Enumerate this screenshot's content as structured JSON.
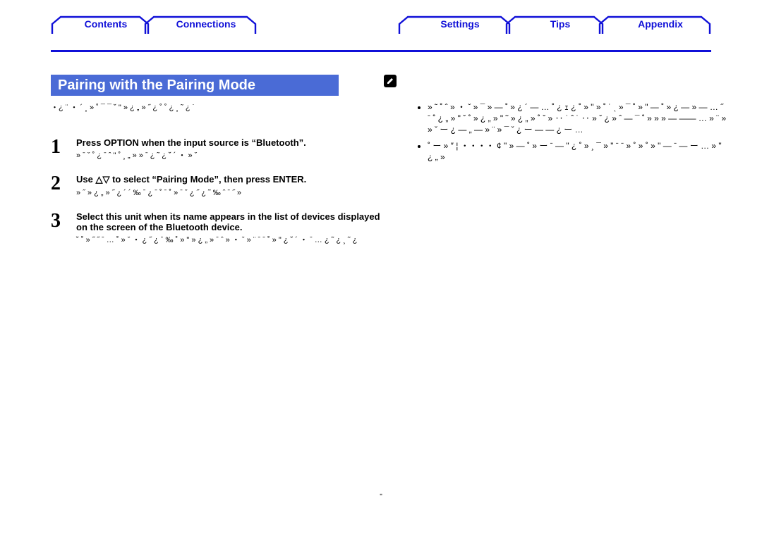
{
  "nav": {
    "contents": "Contents",
    "connections": "Connections",
    "settings": "Settings",
    "tips": "Tips",
    "appendix": "Appendix"
  },
  "section_title": "Pairing with the Pairing Mode",
  "intro_bullet": "・¿ ¨ ・ ´ ¸ » ˚ ¯ ¯ ˘ \" » ¿ „ » ˝ ¿ ˚ ˚ ¿ ¸ ˜ ¿ ˙",
  "steps": [
    {
      "num": "1",
      "strong": "Press OPTION when the input source is “Bluetooth”.",
      "sub": "»   ˉ ˇ ˚ ¿ ˉ ˆ \" ˚ ¸  „ » » ˉ ¿ ˜  ¿ ˘ ´ ・ » ˇ"
    },
    {
      "num": "2",
      "strong": "Use △▽ to select “Pairing Mode”, then press ENTER.",
      "sub": "»  ˝ »  ¿ „ » ˝ ¿ ´ ´ ‰ ˉ  ¿ ˉ ˚ ˉ ˚ » ˉ  ˇ ¿ ˝ ¿ ˜ ‰  ˆ ˉ ˝ »"
    },
    {
      "num": "3",
      "strong": "Select this unit when its name appears in the list of devices displayed on the screen of the Bluetooth device.",
      "sub": "˘ ˚ » ˝ ˝ ˉ … ˚ » ˇ ・ ¿ ˝ ¿ ˉ ‰ ˚ » \" » ¿ „ » ˉ ˆ » ・ ˇ » ¨ ˉ ˉ ˚ » \" ¿ ˘ ´ ・ ˉ …\n ¿ ˜ ¿ ¸ ˜ ¿"
    }
  ],
  "right_bullets": [
    "» ˜ ˚ ˆ » ・ ˇ » ¯ » ― ˚ » ¿ ´ ― … ˚ ¿ ｪ ¿ ˚ » \" » ˚ ˙ ˎ » ¯ ˚ » \" ― ˚ » ¿ ― » ― … ˝ ˉ ˚ ¿ „ » \"   ˇ ˚ » ¿ „ » \" ˜ » ¿ „ »   ˚ ˇ » ‥ ˙ ˆ ˙ ‥ »   ˇ ¿ » ˆ ― ¯ ˚ » » » ― ―― … » ¨ » » ˇ ー ¿ ― „ ― »   ¨ » ¯ ˇ ¿ ー ― ― ¿ ー …",
    "˚ ー » ″ ¦ ・・・・ ¢ \" » ― ˚ » ー ˉ ― \" ¿ ˚ » ¸ ¯ » \" ˉ ˉ » ˚ » ˚ » \" ― ˉ ― ー …   » \" ¿ „ »"
  ],
  "page_mark": "\""
}
